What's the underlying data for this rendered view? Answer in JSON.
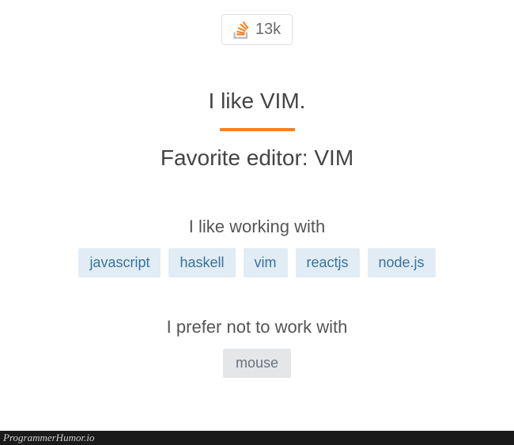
{
  "badge": {
    "reputation": "13k"
  },
  "headline": "I like VIM.",
  "subhead": "Favorite editor: VIM",
  "like": {
    "label": "I like working with",
    "tags": [
      "javascript",
      "haskell",
      "vim",
      "reactjs",
      "node.js"
    ]
  },
  "dislike": {
    "label": "I prefer not to work with",
    "tags": [
      "mouse"
    ]
  },
  "footer": {
    "watermark": "ProgrammerHumor.io"
  },
  "colors": {
    "accent": "#f48024",
    "tag_bg": "#e1ecf4",
    "tag_fg": "#39739d",
    "tag_muted_bg": "#e4e6e8",
    "tag_muted_fg": "#6a737c"
  }
}
